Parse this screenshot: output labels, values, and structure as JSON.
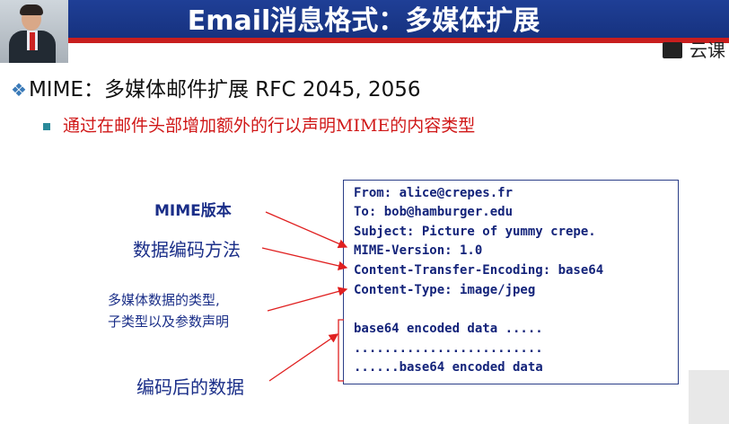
{
  "slide": {
    "title": "Email消息格式：多媒体扩展",
    "brand": "云课",
    "bullet1": "MIME：多媒体邮件扩展 RFC 2045, 2056",
    "bullet1_mark": "❖",
    "bullet2": "通过在邮件头部增加额外的行以声明MIME的内容类型"
  },
  "labels": {
    "version": "MIME版本",
    "encoding": "数据编码方法",
    "type_line1": "多媒体数据的类型,",
    "type_line2": "子类型以及参数声明",
    "data": "编码后的数据"
  },
  "message": {
    "lines": [
      "From: alice@crepes.fr",
      "To: bob@hamburger.edu",
      "Subject: Picture of yummy crepe.",
      "MIME-Version: 1.0",
      "Content-Transfer-Encoding: base64",
      "Content-Type: image/jpeg",
      "",
      "base64 encoded data .....",
      ".........................",
      "......base64 encoded data"
    ]
  },
  "colors": {
    "title_bar": "#1f3f96",
    "accent_red": "#d01818",
    "label_blue": "#1a2e88",
    "arrow_red": "#e02020"
  }
}
